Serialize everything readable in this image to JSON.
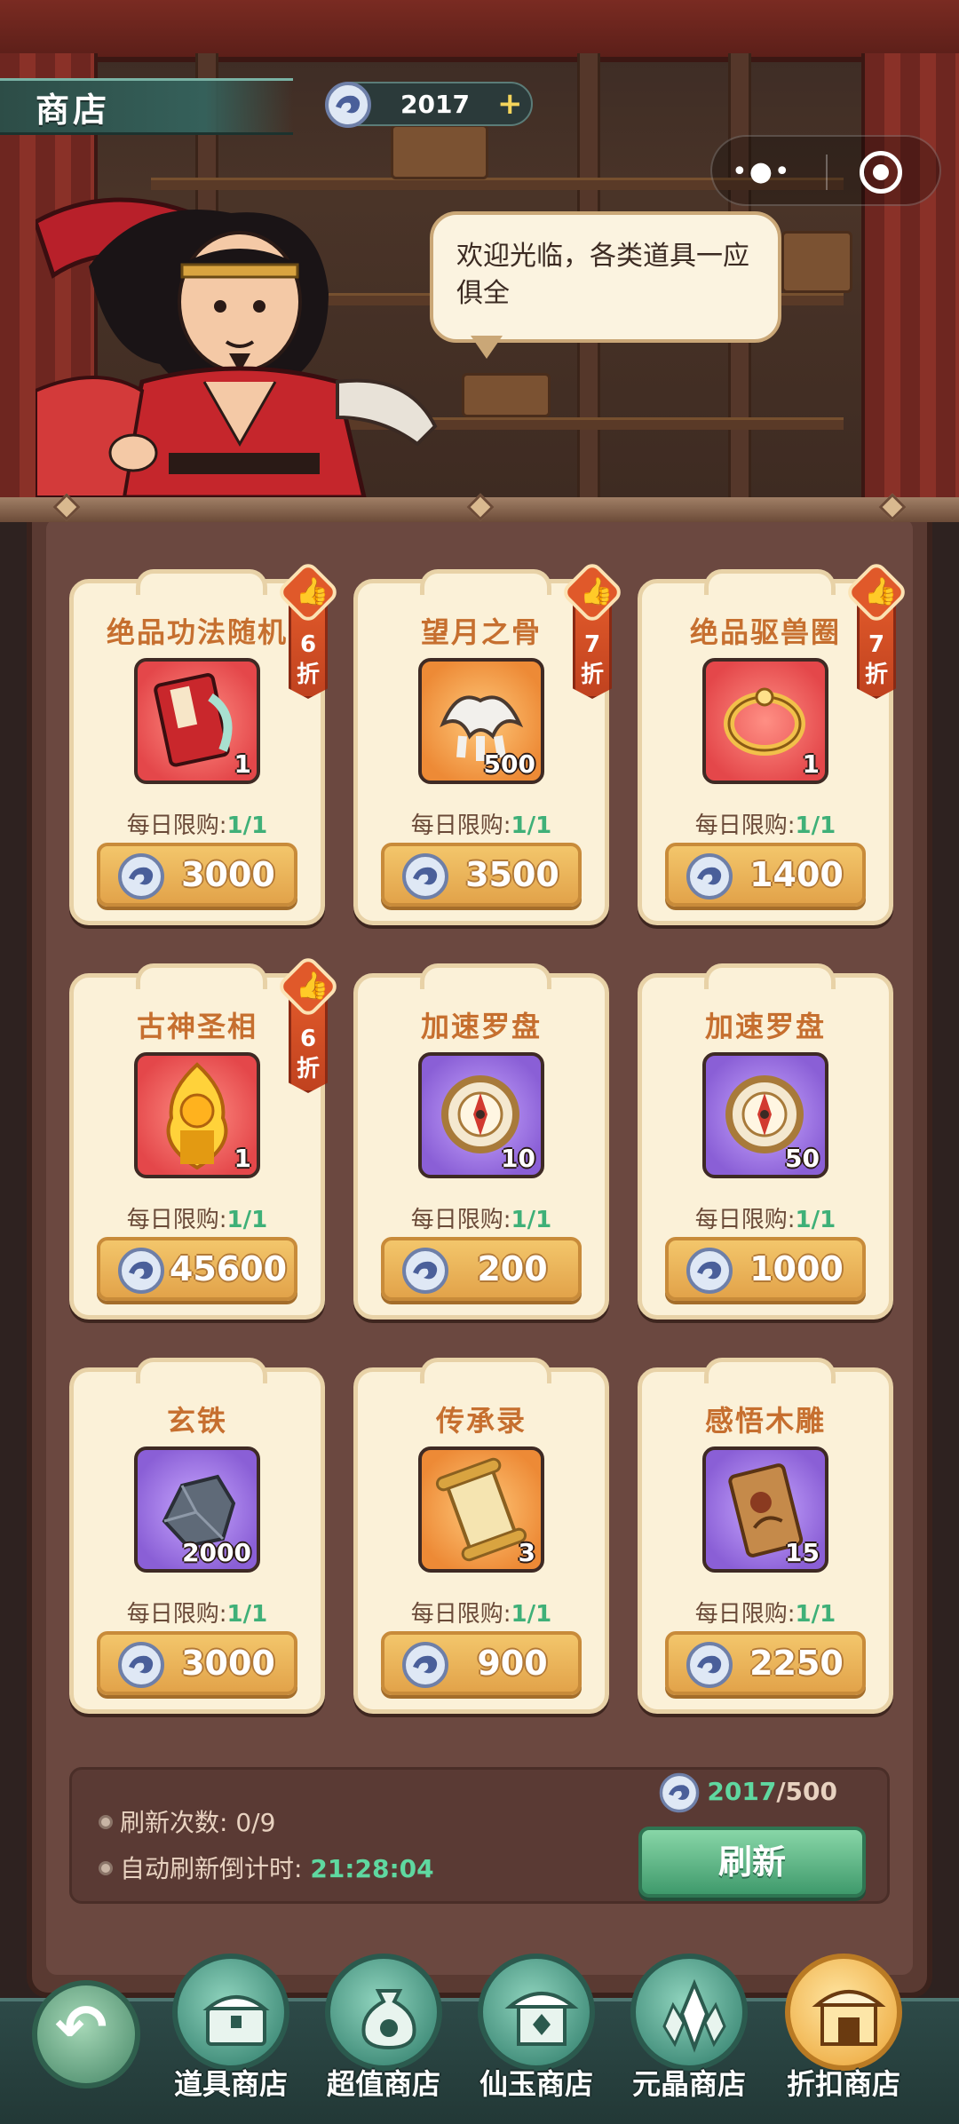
{
  "header": {
    "title": "商店",
    "currency_value": "2017",
    "plus_label": "+",
    "capsule_dots": "•●•"
  },
  "npc": {
    "greeting": "欢迎光临，各类道具一应俱全"
  },
  "items": [
    {
      "name": "绝品功法随机",
      "qty": "1",
      "limit_label": "每日限购:",
      "limit_value": "1/1",
      "price": "3000",
      "discount": "6折",
      "discount_num": "6",
      "discount_unit": "折",
      "bg": "red"
    },
    {
      "name": "望月之骨",
      "qty": "500",
      "limit_label": "每日限购:",
      "limit_value": "1/1",
      "price": "3500",
      "discount": "7折",
      "discount_num": "7",
      "discount_unit": "折",
      "bg": "orange"
    },
    {
      "name": "绝品驱兽圈",
      "qty": "1",
      "limit_label": "每日限购:",
      "limit_value": "1/1",
      "price": "1400",
      "discount": "7折",
      "discount_num": "7",
      "discount_unit": "折",
      "bg": "red"
    },
    {
      "name": "古神圣相",
      "qty": "1",
      "limit_label": "每日限购:",
      "limit_value": "1/1",
      "price": "45600",
      "discount": "6折",
      "discount_num": "6",
      "discount_unit": "折",
      "bg": "red"
    },
    {
      "name": "加速罗盘",
      "qty": "10",
      "limit_label": "每日限购:",
      "limit_value": "1/1",
      "price": "200",
      "bg": "purple"
    },
    {
      "name": "加速罗盘",
      "qty": "50",
      "limit_label": "每日限购:",
      "limit_value": "1/1",
      "price": "1000",
      "bg": "purple"
    },
    {
      "name": "玄铁",
      "qty": "2000",
      "limit_label": "每日限购:",
      "limit_value": "1/1",
      "price": "3000",
      "bg": "purple"
    },
    {
      "name": "传承录",
      "qty": "3",
      "limit_label": "每日限购:",
      "limit_value": "1/1",
      "price": "900",
      "bg": "orange"
    },
    {
      "name": "感悟木雕",
      "qty": "15",
      "limit_label": "每日限购:",
      "limit_value": "1/1",
      "price": "2250",
      "bg": "purple"
    }
  ],
  "refresh": {
    "count_label": "刷新次数: ",
    "count_value": "0/9",
    "timer_label": "自动刷新倒计时: ",
    "timer_value": "21:28:04",
    "cost_have": "2017",
    "cost_sep_need": "/500",
    "button_label": "刷新"
  },
  "nav": {
    "back_glyph": "↶",
    "tabs": [
      {
        "label": "道具商店"
      },
      {
        "label": "超值商店"
      },
      {
        "label": "仙玉商店"
      },
      {
        "label": "元晶商店"
      },
      {
        "label": "折扣商店"
      }
    ]
  },
  "colors": {
    "accent_green": "#3fb078",
    "card_title": "#c66f2f",
    "price_button": "#e2a34a",
    "refresh_button": "#3f9a6c",
    "discount_tag": "#e0592a",
    "active_tab": "#efb04a"
  }
}
